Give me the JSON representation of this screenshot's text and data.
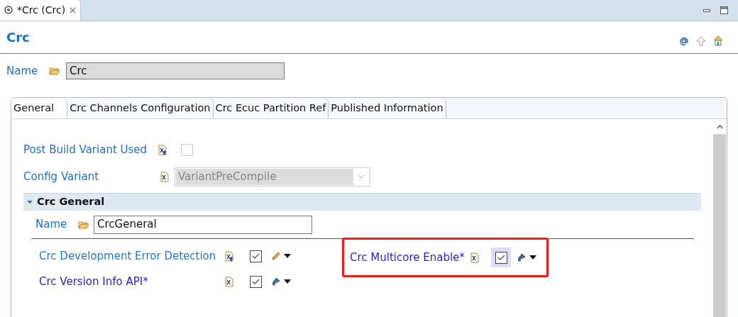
{
  "editor_tab": {
    "title": "*Crc (Crc)"
  },
  "form": {
    "title": "Crc",
    "name_label": "Name",
    "name_value": "Crc"
  },
  "tabs": [
    {
      "label": "General",
      "selected": true
    },
    {
      "label": "Crc Channels Configuration",
      "selected": false
    },
    {
      "label": "Crc Ecuc Partition Ref",
      "selected": false
    },
    {
      "label": "Published Information",
      "selected": false
    }
  ],
  "general": {
    "post_build": {
      "label": "Post Build Variant Used",
      "checked": false
    },
    "config_variant": {
      "label": "Config Variant",
      "value": "VariantPreCompile",
      "disabled": true
    }
  },
  "section": {
    "title": "Crc General",
    "expanded": true,
    "name_label": "Name",
    "name_value": "CrcGeneral",
    "parameters": [
      {
        "label": "Crc Development Error Detection",
        "color": "#1a7ad6",
        "r_badge": true,
        "checked": true,
        "focused": false,
        "kind": "manual",
        "highlighted": false
      },
      {
        "label": "Crc Multicore Enable*",
        "color": "#2a1ccf",
        "r_badge": false,
        "checked": true,
        "focused": true,
        "kind": "derived",
        "highlighted": true
      },
      {
        "label": "Crc Version Info API*",
        "color": "#2a1ccf",
        "r_badge": false,
        "checked": true,
        "focused": false,
        "kind": "derived",
        "highlighted": false
      }
    ]
  }
}
